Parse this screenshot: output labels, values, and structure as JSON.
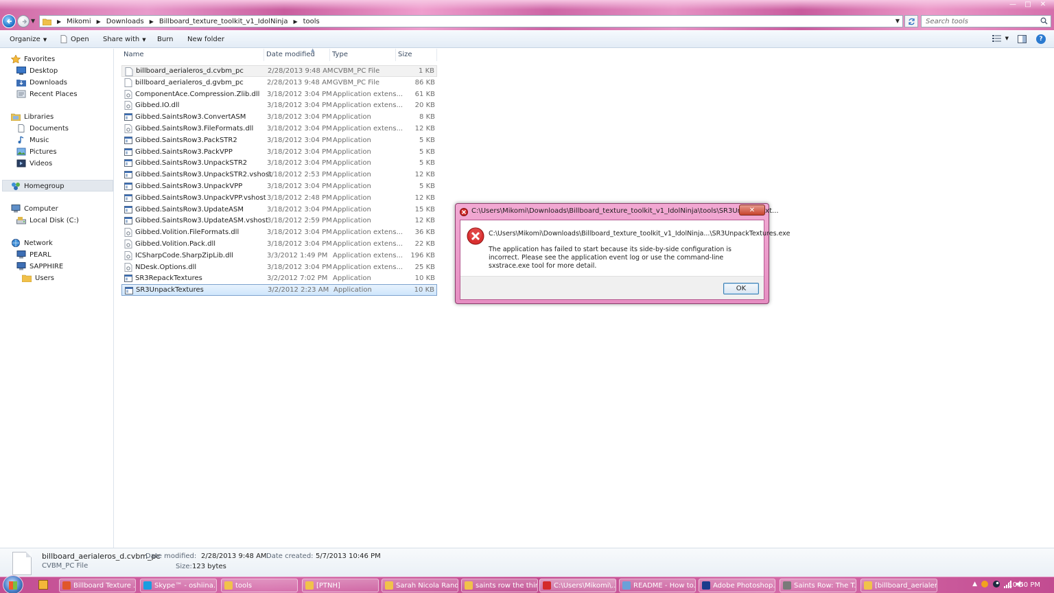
{
  "window": {
    "minimize": "—",
    "maximize": "□",
    "close": "✕"
  },
  "address": {
    "crumbs": [
      "Mikomi",
      "Downloads",
      "Billboard_texture_toolkit_v1_IdolNinja",
      "tools"
    ],
    "search_placeholder": "Search tools"
  },
  "toolbar": {
    "organize": "Organize",
    "open": "Open",
    "share_with": "Share with",
    "burn": "Burn",
    "new_folder": "New folder"
  },
  "nav": {
    "favorites": "Favorites",
    "desktop": "Desktop",
    "downloads": "Downloads",
    "recent_places": "Recent Places",
    "libraries": "Libraries",
    "documents": "Documents",
    "music": "Music",
    "pictures": "Pictures",
    "videos": "Videos",
    "homegroup": "Homegroup",
    "computer": "Computer",
    "local_disk": "Local Disk (C:)",
    "network": "Network",
    "pearl": "PEARL",
    "sapphire": "SAPPHIRE",
    "users": "Users"
  },
  "columns": {
    "name": "Name",
    "date": "Date modified",
    "type": "Type",
    "size": "Size"
  },
  "files": [
    {
      "name": "billboard_aerialeros_d.cvbm_pc",
      "date": "2/28/2013 9:48 AM",
      "type": "CVBM_PC File",
      "size": "1 KB",
      "icon": "file-icon"
    },
    {
      "name": "billboard_aerialeros_d.gvbm_pc",
      "date": "2/28/2013 9:48 AM",
      "type": "GVBM_PC File",
      "size": "86 KB",
      "icon": "file-icon"
    },
    {
      "name": "ComponentAce.Compression.Zlib.dll",
      "date": "3/18/2012 3:04 PM",
      "type": "Application extens...",
      "size": "61 KB",
      "icon": "dll-icon"
    },
    {
      "name": "Gibbed.IO.dll",
      "date": "3/18/2012 3:04 PM",
      "type": "Application extens...",
      "size": "20 KB",
      "icon": "dll-icon"
    },
    {
      "name": "Gibbed.SaintsRow3.ConvertASM",
      "date": "3/18/2012 3:04 PM",
      "type": "Application",
      "size": "8 KB",
      "icon": "exe-icon"
    },
    {
      "name": "Gibbed.SaintsRow3.FileFormats.dll",
      "date": "3/18/2012 3:04 PM",
      "type": "Application extens...",
      "size": "12 KB",
      "icon": "dll-icon"
    },
    {
      "name": "Gibbed.SaintsRow3.PackSTR2",
      "date": "3/18/2012 3:04 PM",
      "type": "Application",
      "size": "5 KB",
      "icon": "exe-icon"
    },
    {
      "name": "Gibbed.SaintsRow3.PackVPP",
      "date": "3/18/2012 3:04 PM",
      "type": "Application",
      "size": "5 KB",
      "icon": "exe-icon"
    },
    {
      "name": "Gibbed.SaintsRow3.UnpackSTR2",
      "date": "3/18/2012 3:04 PM",
      "type": "Application",
      "size": "5 KB",
      "icon": "exe-icon"
    },
    {
      "name": "Gibbed.SaintsRow3.UnpackSTR2.vshost",
      "date": "3/18/2012 2:53 PM",
      "type": "Application",
      "size": "12 KB",
      "icon": "exe-icon"
    },
    {
      "name": "Gibbed.SaintsRow3.UnpackVPP",
      "date": "3/18/2012 3:04 PM",
      "type": "Application",
      "size": "5 KB",
      "icon": "exe-icon"
    },
    {
      "name": "Gibbed.SaintsRow3.UnpackVPP.vshost",
      "date": "3/18/2012 2:48 PM",
      "type": "Application",
      "size": "12 KB",
      "icon": "exe-icon"
    },
    {
      "name": "Gibbed.SaintsRow3.UpdateASM",
      "date": "3/18/2012 3:04 PM",
      "type": "Application",
      "size": "15 KB",
      "icon": "exe-icon"
    },
    {
      "name": "Gibbed.SaintsRow3.UpdateASM.vshost",
      "date": "3/18/2012 2:59 PM",
      "type": "Application",
      "size": "12 KB",
      "icon": "exe-icon"
    },
    {
      "name": "Gibbed.Volition.FileFormats.dll",
      "date": "3/18/2012 3:04 PM",
      "type": "Application extens...",
      "size": "36 KB",
      "icon": "dll-icon"
    },
    {
      "name": "Gibbed.Volition.Pack.dll",
      "date": "3/18/2012 3:04 PM",
      "type": "Application extens...",
      "size": "22 KB",
      "icon": "dll-icon"
    },
    {
      "name": "ICSharpCode.SharpZipLib.dll",
      "date": "3/3/2012 1:49 PM",
      "type": "Application extens...",
      "size": "196 KB",
      "icon": "dll-icon"
    },
    {
      "name": "NDesk.Options.dll",
      "date": "3/18/2012 3:04 PM",
      "type": "Application extens...",
      "size": "25 KB",
      "icon": "dll-icon"
    },
    {
      "name": "SR3RepackTextures",
      "date": "3/2/2012 7:02 PM",
      "type": "Application",
      "size": "10 KB",
      "icon": "exe-icon"
    },
    {
      "name": "SR3UnpackTextures",
      "date": "3/2/2012 2:23 AM",
      "type": "Application",
      "size": "10 KB",
      "icon": "exe-icon"
    }
  ],
  "details": {
    "filename": "billboard_aerialeros_d.cvbm_pc",
    "filetype": "CVBM_PC File",
    "modified_label": "Date modified:",
    "modified": "2/28/2013 9:48 AM",
    "created_label": "Date created:",
    "created": "5/7/2013 10:46 PM",
    "size_label": "Size:",
    "size": "123 bytes"
  },
  "dialog": {
    "title": "C:\\Users\\Mikomi\\Downloads\\Billboard_texture_toolkit_v1_IdolNinja\\tools\\SR3UnpackText...",
    "path": "C:\\Users\\Mikomi\\Downloads\\Billboard_texture_toolkit_v1_IdolNinja...\\SR3UnpackTextures.exe",
    "message": "The application has failed to start because its side-by-side configuration is incorrect. Please see the application event log or use the command-line sxstrace.exe tool for more detail.",
    "ok": "OK",
    "close": "✕"
  },
  "taskbar": {
    "tasks": [
      {
        "label": "Billboard Texture ...",
        "color": "#e0562a"
      },
      {
        "label": "Skype™ - oshiina...",
        "color": "#1a9de0"
      },
      {
        "label": "tools",
        "color": "#f1c24a"
      },
      {
        "label": "[PTNH]",
        "color": "#f1c24a"
      },
      {
        "label": "Sarah Nicola Rand...",
        "color": "#f1c24a"
      },
      {
        "label": "saints row the third",
        "color": "#f1c24a"
      },
      {
        "label": "C:\\Users\\Mikomi\\...",
        "color": "#d42a2a"
      },
      {
        "label": "README - How to...",
        "color": "#6aa0d8"
      },
      {
        "label": "Adobe Photoshop...",
        "color": "#1b3c8c"
      },
      {
        "label": "Saints Row: The T...",
        "color": "#7a7a7a"
      },
      {
        "label": "[billboard_aerialer...",
        "color": "#f1c24a"
      }
    ],
    "clock": "10:50 PM"
  }
}
